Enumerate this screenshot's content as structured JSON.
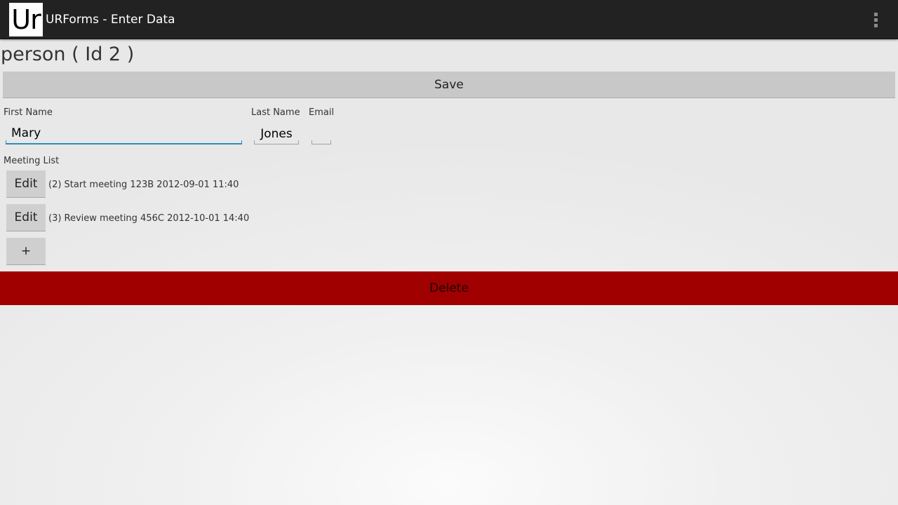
{
  "actionbar": {
    "logo_text": "Ur",
    "title": "URForms - Enter Data",
    "overflow_icon": "overflow-menu-icon"
  },
  "page": {
    "title": "person ( Id 2 )"
  },
  "buttons": {
    "save": "Save",
    "delete": "Delete",
    "add": "+",
    "edit": "Edit"
  },
  "fields": {
    "first_name": {
      "label": "First Name",
      "value": "Mary"
    },
    "last_name": {
      "label": "Last Name",
      "value": "Jones"
    },
    "email": {
      "label": "Email",
      "value": ""
    }
  },
  "meetings": {
    "label": "Meeting List",
    "items": [
      {
        "edit_label": "Edit",
        "text": "(2) Start meeting 123B 2012-09-01 11:40"
      },
      {
        "edit_label": "Edit",
        "text": "(3) Review meeting 456C 2012-10-01 14:40"
      }
    ]
  },
  "colors": {
    "actionbar": "#222222",
    "focus_accent": "#2a8fb8",
    "delete_bg": "#a00000",
    "button_bg": "#c8c8c8"
  }
}
